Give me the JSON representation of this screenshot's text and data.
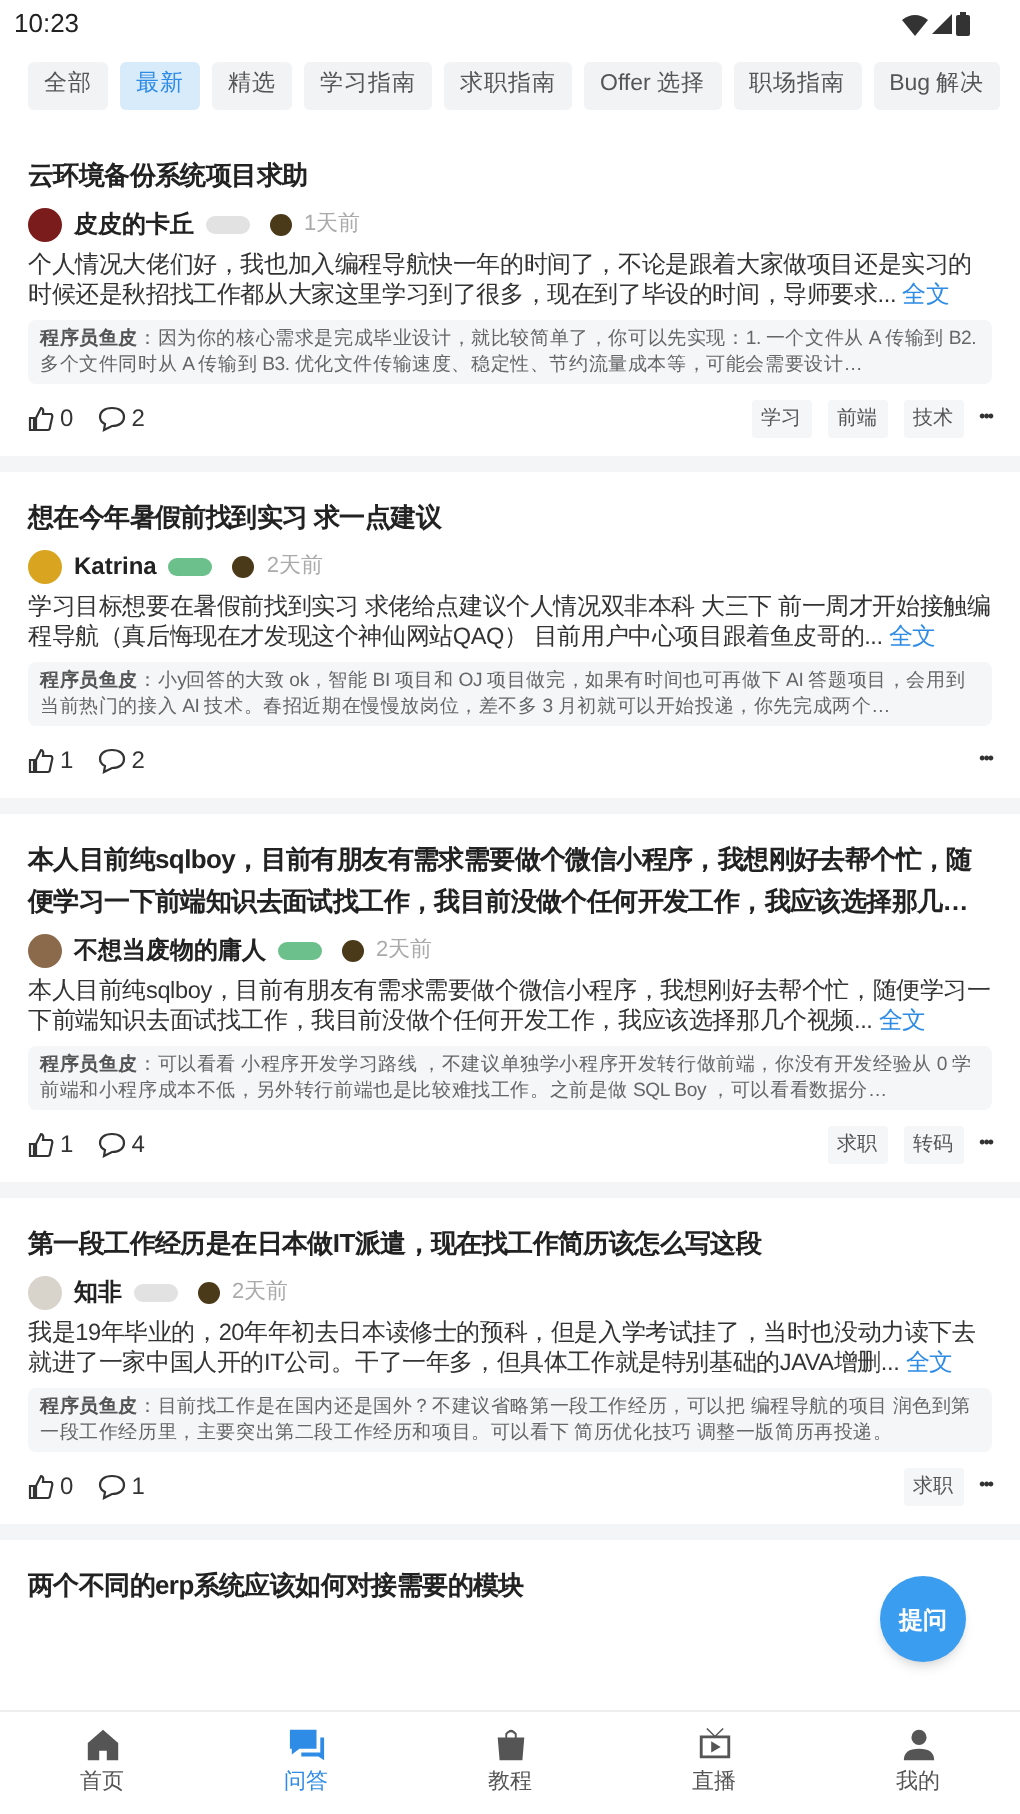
{
  "status_bar": {
    "time": "10:23"
  },
  "tabs": [
    {
      "label": "全部",
      "selected": false
    },
    {
      "label": "最新",
      "selected": true
    },
    {
      "label": "精选",
      "selected": false
    },
    {
      "label": "学习指南",
      "selected": false
    },
    {
      "label": "求职指南",
      "selected": false
    },
    {
      "label": "Offer 选择",
      "selected": false
    },
    {
      "label": "职场指南",
      "selected": false
    },
    {
      "label": "Bug 解决",
      "selected": false
    }
  ],
  "posts": [
    {
      "title": "云环境备份系统项目求助",
      "author": "皮皮的卡丘",
      "time": "1天前",
      "body": "个人情况大佬们好，我也加入编程导航快一年的时间了，不论是跟着大家做项目还是实习的时候还是秋招找工作都从大家这里学习到了很多，现在到了毕设的时间，导师要求...",
      "more": "全文",
      "reply": {
        "author": "程序员鱼皮",
        "text": "：因为你的核心需求是完成毕业设计，就比较简单了，你可以先实现：1. 一个文件从 A 传输到 B2. 多个文件同时从 A 传输到 B3. 优化文件传输速度、稳定性、节约流量成本等，可能会需要设计…"
      },
      "likes": "0",
      "comments": "2",
      "tags": [
        "学习",
        "前端",
        "技术"
      ],
      "more_menu": "•••"
    },
    {
      "title": "想在今年暑假前找到实习 求一点建议",
      "author": "Katrina",
      "time": "2天前",
      "body": "学习目标想要在暑假前找到实习 求佬给点建议个人情况双非本科 大三下 前一周才开始接触编程导航（真后悔现在才发现这个神仙网站QAQ） 目前用户中心项目跟着鱼皮哥的...",
      "more": "全文",
      "reply": {
        "author": "程序员鱼皮",
        "text": "：小y回答的大致 ok，智能 BI 项目和 OJ 项目做完，如果有时间也可再做下 AI 答题项目，会用到当前热门的接入 AI 技术。春招近期在慢慢放岗位，差不多 3 月初就可以开始投递，你先完成两个…"
      },
      "likes": "1",
      "comments": "2",
      "more_menu": "•••"
    },
    {
      "title": "本人目前纯sqlboy，目前有朋友有需求需要做个微信小程序，我想刚好去帮个忙，随便学习一下前端知识去面试找工作，我目前没做个任何开发工作，我应该选择那几…",
      "author": "不想当废物的庸人",
      "time": "2天前",
      "body": "本人目前纯sqlboy，目前有朋友有需求需要做个微信小程序，我想刚好去帮个忙，随便学习一下前端知识去面试找工作，我目前没做个任何开发工作，我应该选择那几个视频...",
      "more": "全文",
      "reply": {
        "author": "程序员鱼皮",
        "text": "：可以看看 小程序开发学习路线 ，不建议单独学小程序开发转行做前端，你没有开发经验从 0 学前端和小程序成本不低，另外转行前端也是比较难找工作。之前是做 SQL Boy ，可以看看数据分…"
      },
      "likes": "1",
      "comments": "4",
      "tags": [
        "求职",
        "转码"
      ],
      "more_menu": "•••"
    },
    {
      "title": "第一段工作经历是在日本做IT派遣，现在找工作简历该怎么写这段",
      "author": "知非",
      "time": "2天前",
      "body": "我是19年毕业的，20年年初去日本读修士的预科，但是入学考试挂了，当时也没动力读下去就进了一家中国人开的IT公司。干了一年多，但具体工作就是特别基础的JAVA增删...",
      "more": "全文",
      "reply": {
        "author": "程序员鱼皮",
        "text": "：目前找工作是在国内还是国外？不建议省略第一段工作经历，可以把 编程导航的项目 润色到第一段工作经历里，主要突出第二段工作经历和项目。可以看下 简历优化技巧 调整一版简历再投递。"
      },
      "likes": "0",
      "comments": "1",
      "tags": [
        "求职"
      ],
      "more_menu": "•••"
    },
    {
      "title": "两个不同的erp系统应该如何对接需要的模块"
    }
  ],
  "fab": "提问",
  "nav": [
    {
      "label": "首页",
      "selected": false
    },
    {
      "label": "问答",
      "selected": true
    },
    {
      "label": "教程",
      "selected": false
    },
    {
      "label": "直播",
      "selected": false
    },
    {
      "label": "我的",
      "selected": false
    }
  ]
}
